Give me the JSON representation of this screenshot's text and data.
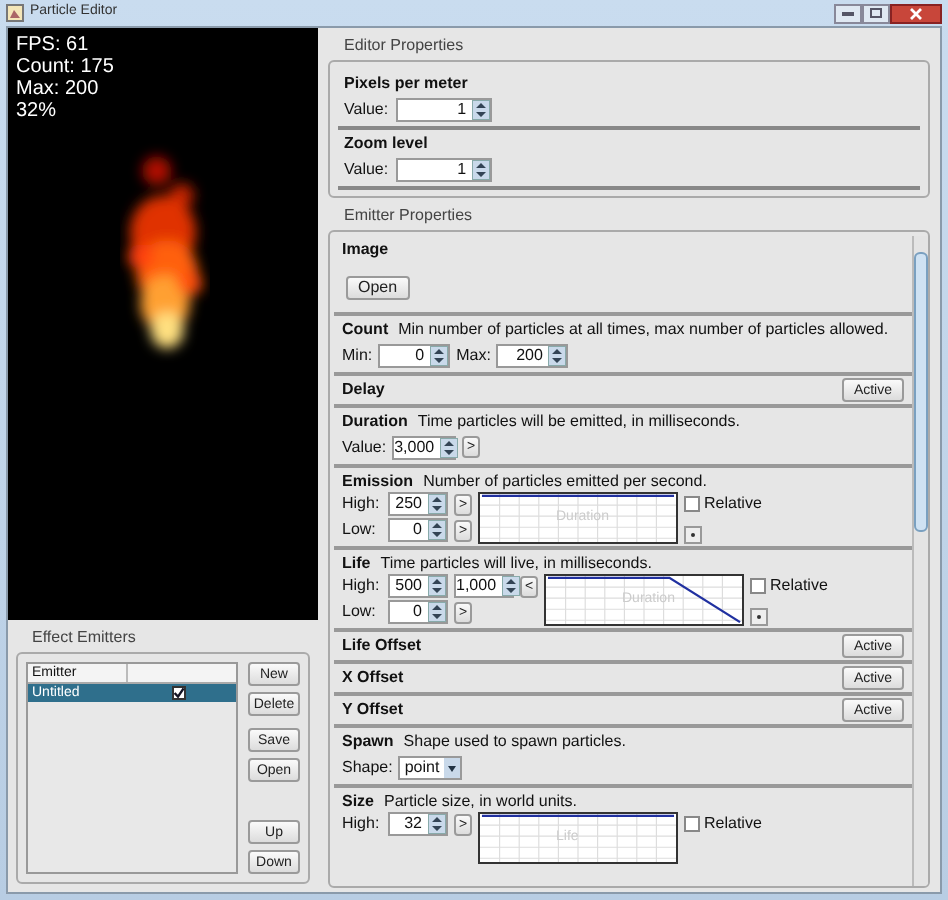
{
  "window": {
    "title": "Particle Editor"
  },
  "preview": {
    "stats": [
      "FPS: 61",
      "Count: 175",
      "Max: 200",
      "32%"
    ]
  },
  "effect_emitters": {
    "title": "Effect Emitters",
    "columns": [
      "Emitter"
    ],
    "rows": [
      {
        "name": "Untitled",
        "checked": true,
        "selected": true
      }
    ],
    "buttons": [
      "New",
      "Delete",
      "Save",
      "Open",
      "Up",
      "Down"
    ]
  },
  "editor_properties": {
    "title": "Editor Properties",
    "sections": [
      {
        "title": "Pixels per meter",
        "label": "Value:",
        "value": "1"
      },
      {
        "title": "Zoom level",
        "label": "Value:",
        "value": "1"
      }
    ]
  },
  "emitter_properties": {
    "title": "Emitter Properties",
    "sections": [
      {
        "title": "Image",
        "button": "Open"
      },
      {
        "kind": "range",
        "title": "Count",
        "description": "Min number of particles at all times, max number of particles allowed.",
        "fields": [
          {
            "label": "Min:",
            "value": "0"
          },
          {
            "label": "Max:",
            "value": "200"
          }
        ]
      },
      {
        "kind": "toggle",
        "title": "Delay",
        "button": "Active"
      },
      {
        "kind": "value",
        "title": "Duration",
        "description": "Time particles will be emitted, in milliseconds.",
        "fields": [
          {
            "label": "Value:",
            "value": "3,000"
          }
        ],
        "expand": ">"
      },
      {
        "kind": "graph",
        "title": "Emission",
        "description": "Number of particles emitted per second.",
        "graph": {
          "kind": "flat",
          "label": "Duration"
        },
        "relative": {
          "label": "Relative",
          "checked": false
        },
        "rows": [
          {
            "label": "High:",
            "values": [
              "250"
            ],
            "toggle": ">"
          },
          {
            "label": "Low:",
            "values": [
              "0"
            ],
            "toggle": ">"
          }
        ]
      },
      {
        "kind": "graph",
        "title": "Life",
        "description": "Time particles will live, in milliseconds.",
        "graph": {
          "kind": "falling",
          "label": "Duration"
        },
        "relative": {
          "label": "Relative",
          "checked": false
        },
        "rows": [
          {
            "label": "High:",
            "values": [
              "500",
              "1,000"
            ],
            "toggle": "<"
          },
          {
            "label": "Low:",
            "values": [
              "0"
            ],
            "toggle": ">"
          }
        ]
      },
      {
        "kind": "toggle",
        "title": "Life Offset",
        "button": "Active"
      },
      {
        "kind": "toggle",
        "title": "X Offset",
        "button": "Active"
      },
      {
        "kind": "toggle",
        "title": "Y Offset",
        "button": "Active"
      },
      {
        "kind": "shape",
        "title": "Spawn",
        "description": "Shape used to spawn particles.",
        "label": "Shape:",
        "value": "point"
      },
      {
        "kind": "graph",
        "title": "Size",
        "description": "Particle size, in world units.",
        "graph": {
          "kind": "flat",
          "label": "Life"
        },
        "relative": {
          "label": "Relative",
          "checked": false
        },
        "rows": [
          {
            "label": "High:",
            "values": [
              "32"
            ],
            "toggle": ">"
          }
        ]
      }
    ]
  }
}
